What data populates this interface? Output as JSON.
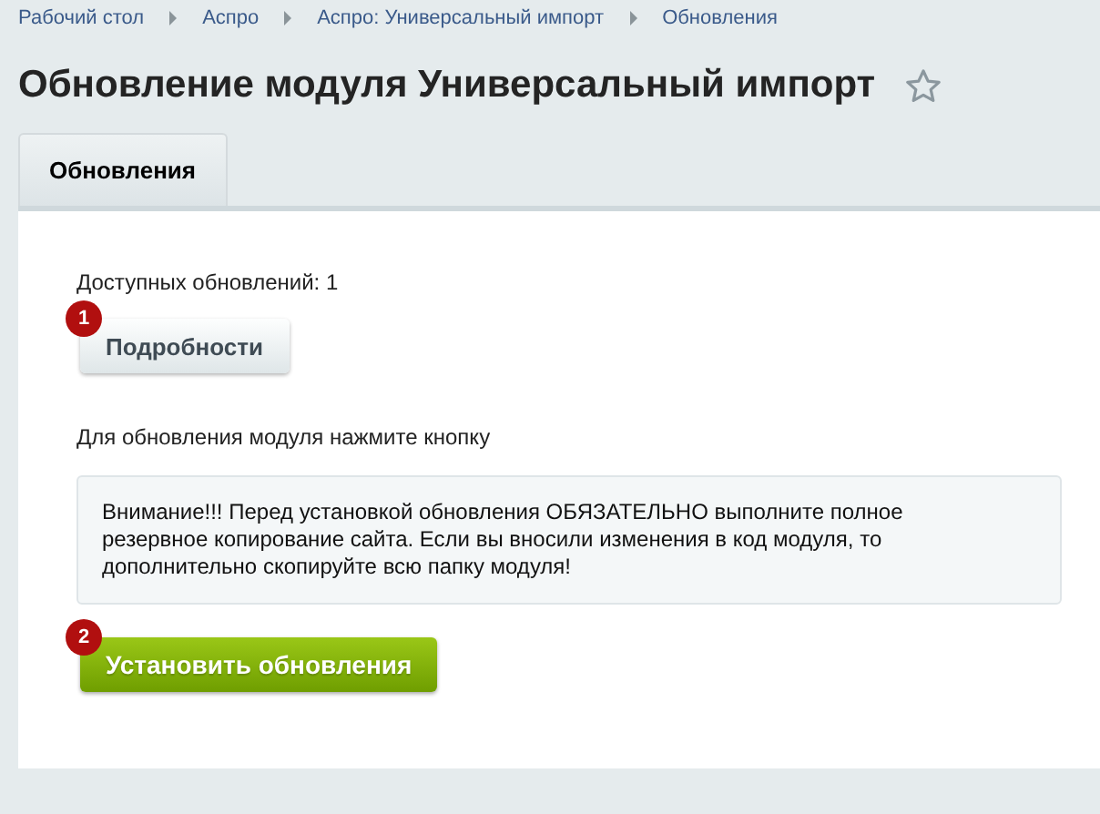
{
  "breadcrumbs": [
    "Рабочий стол",
    "Аспро",
    "Аспро: Универсальный импорт",
    "Обновления"
  ],
  "title": "Обновление модуля Универсальный импорт",
  "favorite": false,
  "tabs": [
    {
      "label": "Обновления",
      "selected": true
    }
  ],
  "content": {
    "available": "Доступных обновлений: 1",
    "details_button": {
      "label": "Подробности",
      "kind": "secondary",
      "marker": "1"
    },
    "instruction": "Для обновления модуля нажмите кнопку",
    "notice": "Внимание!!! Перед установкой обновления ОБЯЗАТЕЛЬНО выполните полное резервное копирование сайта. Если вы вносили изменения в код модуля, то дополнительно скопируйте всю папку модуля!",
    "install_button": {
      "label": "Установить обновления",
      "kind": "primary",
      "marker": "2"
    }
  }
}
